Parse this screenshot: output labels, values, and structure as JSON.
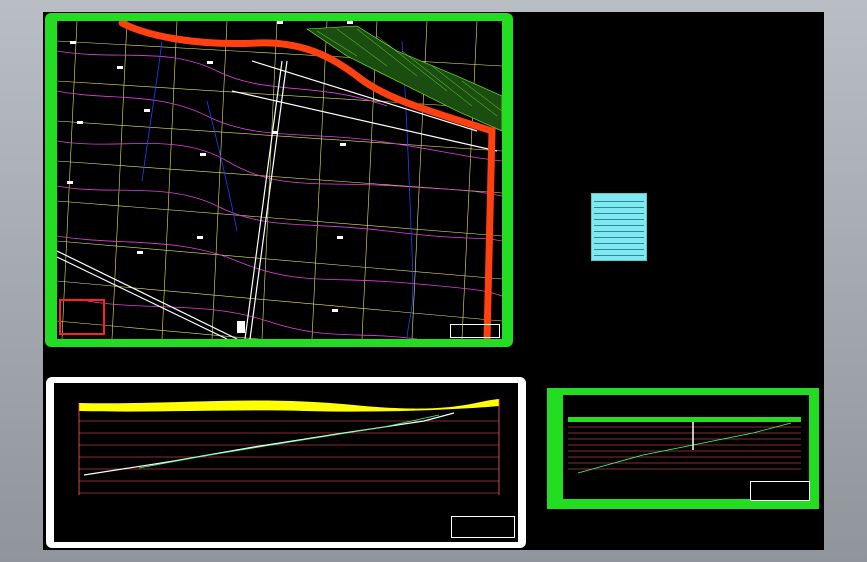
{
  "viewer": {
    "background": "#000000",
    "frame_color": "#9aa0a6"
  },
  "plan_sheet": {
    "border_color": "#22dd22",
    "contour_color": "#e040e0",
    "grid_color": "#e8e860",
    "road_color": "#ff4010",
    "hatch_color": "#80ff40",
    "map_label": "",
    "legend_text": "",
    "titleblock_text": ""
  },
  "profile_sheet": {
    "border_color": "#ffffff",
    "band_color": "#ffff00",
    "section_line_color": "#ff6060",
    "title": ""
  },
  "section_sheet": {
    "border_color": "#22dd22",
    "title": "",
    "titleblock_text": ""
  },
  "table_sheet": {
    "background": "#7fe8f0"
  }
}
